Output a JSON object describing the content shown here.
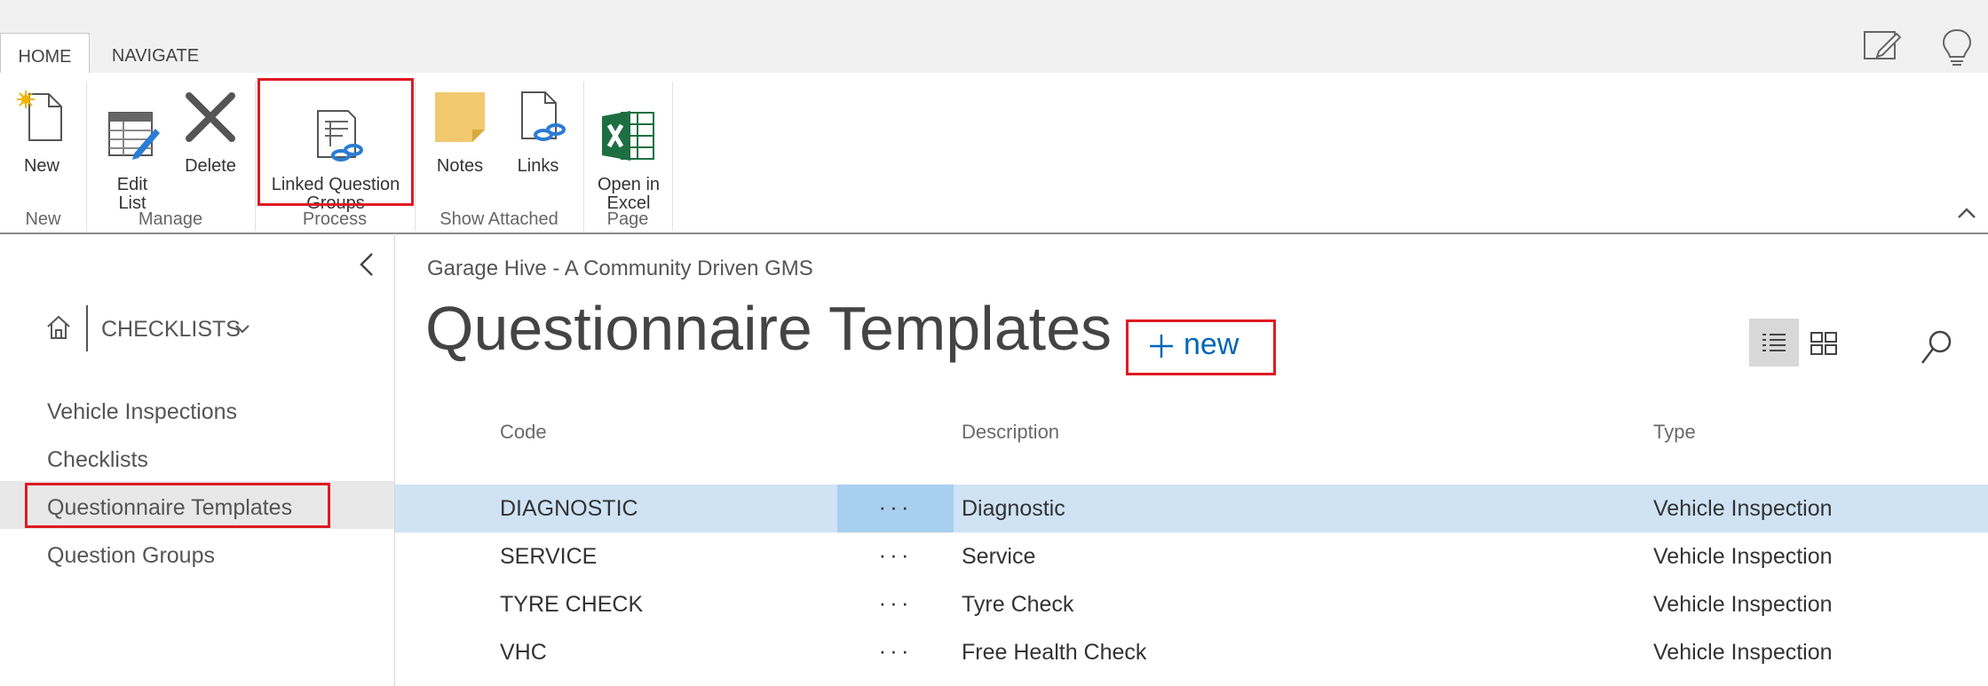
{
  "tabs": [
    {
      "label": "HOME",
      "active": true
    },
    {
      "label": "NAVIGATE",
      "active": false
    }
  ],
  "ribbon": {
    "new": {
      "label": "New",
      "group": "New"
    },
    "manage": {
      "edit_list": "Edit\nList",
      "delete": "Delete",
      "group": "Manage"
    },
    "process": {
      "linked_question_groups": "Linked Question\nGroups",
      "group": "Process"
    },
    "show_attached": {
      "notes": "Notes",
      "links": "Links",
      "group": "Show Attached"
    },
    "page": {
      "open_in_excel": "Open in\nExcel",
      "group": "Page"
    }
  },
  "sidebar": {
    "area": "CHECKLISTS",
    "items": [
      {
        "label": "Vehicle Inspections"
      },
      {
        "label": "Checklists"
      },
      {
        "label": "Questionnaire Templates",
        "selected": true
      },
      {
        "label": "Question Groups"
      }
    ]
  },
  "main": {
    "company": "Garage Hive - A Community Driven GMS",
    "title": "Questionnaire Templates",
    "new_label": "new",
    "columns": {
      "code": "Code",
      "description": "Description",
      "type": "Type"
    },
    "rows": [
      {
        "code": "DIAGNOSTIC",
        "description": "Diagnostic",
        "type": "Vehicle Inspection",
        "selected": true
      },
      {
        "code": "SERVICE",
        "description": "Service",
        "type": "Vehicle Inspection"
      },
      {
        "code": "TYRE CHECK",
        "description": "Tyre Check",
        "type": "Vehicle Inspection"
      },
      {
        "code": "VHC",
        "description": "Free Health Check",
        "type": "Vehicle Inspection"
      }
    ],
    "row_action": "···"
  },
  "colors": {
    "accent": "#0067b8",
    "highlight": "#e01a22",
    "selected_row": "#cfe3f5",
    "selected_dots": "#a9cfee",
    "selected_nav": "#e8e8e8"
  },
  "icons": [
    "new-document-icon",
    "edit-list-icon",
    "delete-icon",
    "linked-groups-icon",
    "notes-icon",
    "links-icon",
    "excel-icon",
    "edit-page-icon",
    "lightbulb-icon",
    "collapse-ribbon-icon",
    "collapse-nav-icon",
    "home-icon",
    "chevron-down-icon",
    "list-view-icon",
    "tile-view-icon",
    "search-icon"
  ]
}
